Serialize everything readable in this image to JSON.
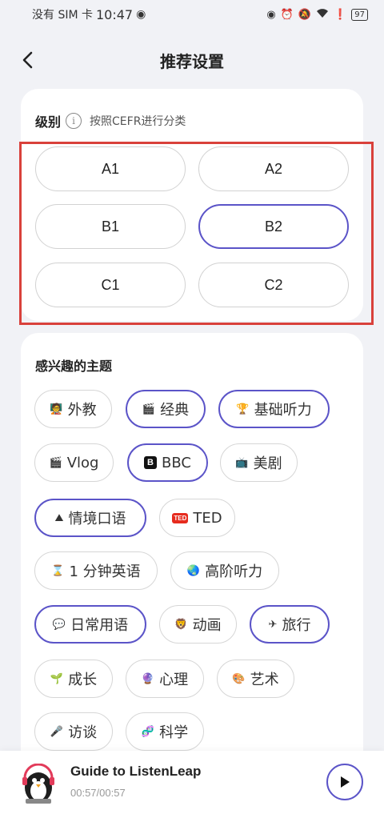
{
  "status": {
    "carrier": "没有 SIM 卡",
    "time": "10:47",
    "battery": "97"
  },
  "header": {
    "title": "推荐设置"
  },
  "level": {
    "title": "级别",
    "info_glyph": "i",
    "subtitle": "按照CEFR进行分类",
    "options": [
      {
        "label": "A1",
        "selected": false
      },
      {
        "label": "A2",
        "selected": false
      },
      {
        "label": "B1",
        "selected": false
      },
      {
        "label": "B2",
        "selected": true
      },
      {
        "label": "C1",
        "selected": false
      },
      {
        "label": "C2",
        "selected": false
      }
    ]
  },
  "topics": {
    "title": "感兴趣的主题",
    "items": [
      {
        "label": "外教",
        "icon": "🧑‍🏫",
        "selected": false
      },
      {
        "label": "经典",
        "icon": "🎬",
        "selected": true
      },
      {
        "label": "基础听力",
        "icon": "🏆",
        "selected": true
      },
      {
        "label": "Vlog",
        "icon": "🎬",
        "selected": false
      },
      {
        "label": "BBC",
        "icon": "B",
        "selected": true
      },
      {
        "label": "美剧",
        "icon": "📺",
        "selected": false
      },
      {
        "label": "情境口语",
        "icon": "⛰",
        "selected": true
      },
      {
        "label": "TED",
        "icon": "TED",
        "selected": false
      },
      {
        "label": "1 分钟英语",
        "icon": "⌛",
        "selected": false
      },
      {
        "label": "高阶听力",
        "icon": "🌏",
        "selected": false
      },
      {
        "label": "日常用语",
        "icon": "💬",
        "selected": true
      },
      {
        "label": "动画",
        "icon": "🦁",
        "selected": false
      },
      {
        "label": "旅行",
        "icon": "✈",
        "selected": true
      },
      {
        "label": "成长",
        "icon": "🌱",
        "selected": false
      },
      {
        "label": "心理",
        "icon": "🔮",
        "selected": false
      },
      {
        "label": "艺术",
        "icon": "🎨",
        "selected": false
      },
      {
        "label": "访谈",
        "icon": "🎤",
        "selected": false
      },
      {
        "label": "科学",
        "icon": "🧬",
        "selected": false
      }
    ]
  },
  "player": {
    "title": "Guide to ListenLeap",
    "time": "00:57/00:57"
  },
  "colors": {
    "accent": "#5b54c8",
    "highlight": "#d9413b"
  }
}
